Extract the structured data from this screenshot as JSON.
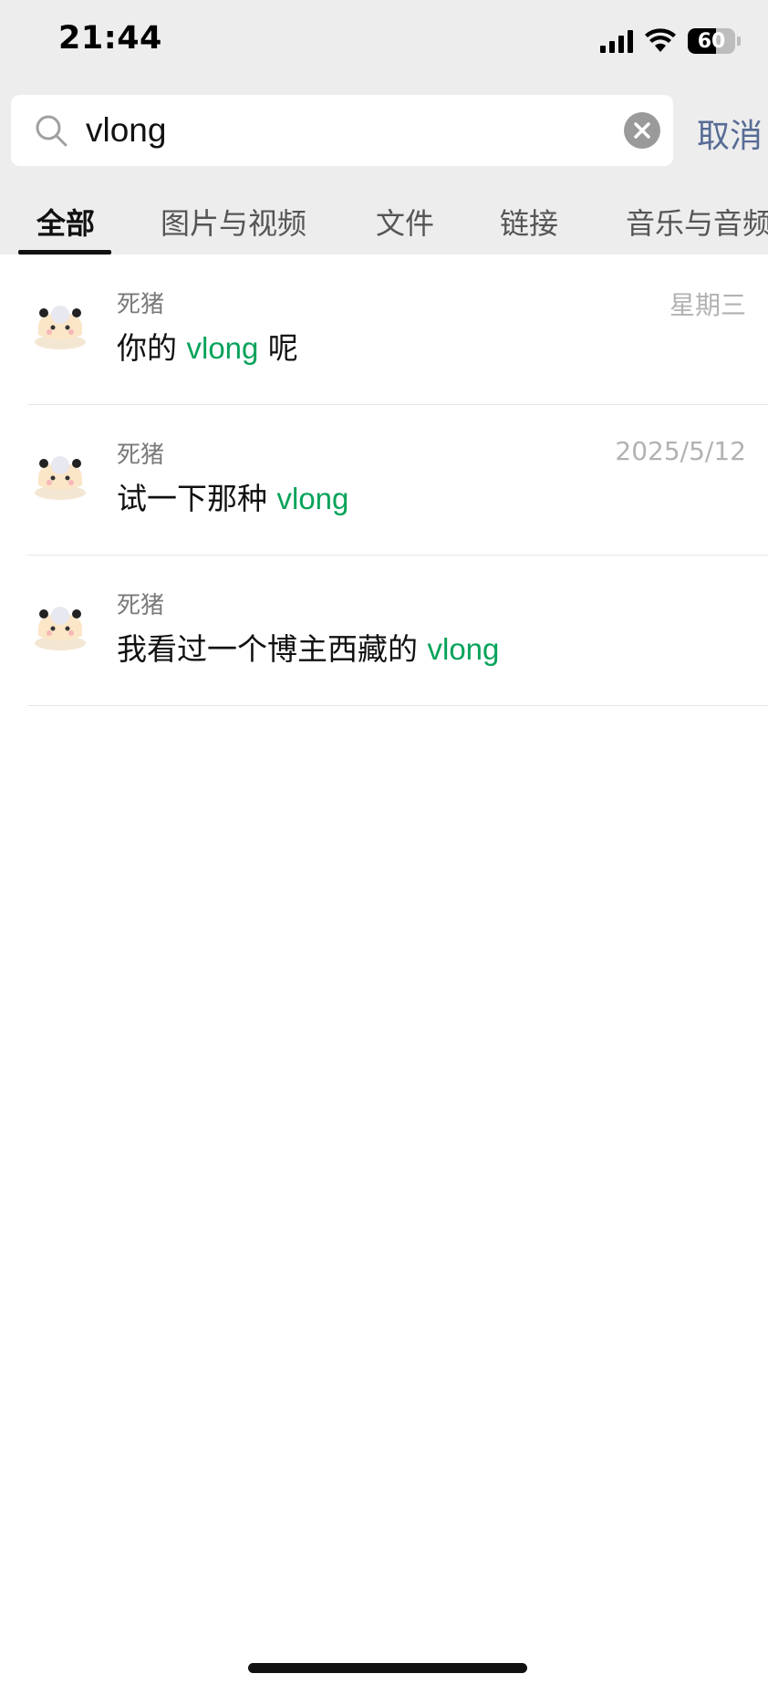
{
  "status_bar": {
    "time": "21:44",
    "battery_level": "60",
    "signal_icon": "signal-bars-icon",
    "wifi_icon": "wifi-icon"
  },
  "search": {
    "value": "vlong",
    "cancel_label": "取消",
    "search_icon": "search-icon",
    "clear_icon": "clear-icon"
  },
  "tabs": [
    {
      "label": "全部"
    },
    {
      "label": "图片与视频"
    },
    {
      "label": "文件"
    },
    {
      "label": "链接"
    },
    {
      "label": "音乐与音频"
    }
  ],
  "results": [
    {
      "sender": "死猪",
      "date": "星期三",
      "text_before": "你的 ",
      "highlight": "vlong",
      "text_after": " 呢"
    },
    {
      "sender": "死猪",
      "date": "2025/5/12",
      "text_before": "试一下那种 ",
      "highlight": "vlong",
      "text_after": ""
    },
    {
      "sender": "死猪",
      "date": "",
      "text_before": "我看过一个博主西藏的 ",
      "highlight": "vlong",
      "text_after": ""
    }
  ],
  "colors": {
    "highlight": "#07a35a",
    "cancel": "#576b95",
    "header_bg": "#ededed"
  }
}
